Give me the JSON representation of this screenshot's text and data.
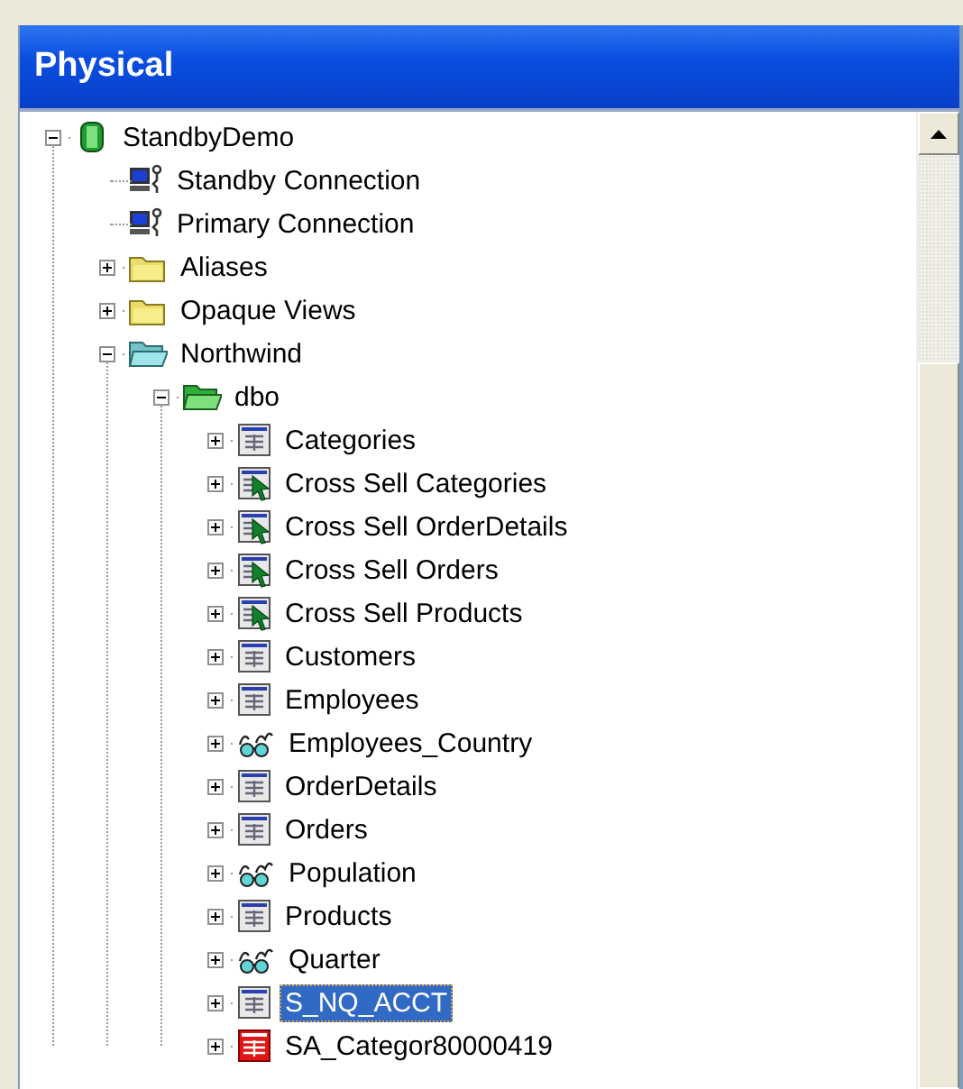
{
  "panel": {
    "title": "Physical"
  },
  "tree": [
    {
      "label": "StandbyDemo",
      "kind": "database",
      "expanded": true,
      "selected": false,
      "children": [
        {
          "label": "Standby Connection",
          "kind": "connection",
          "selected": false
        },
        {
          "label": "Primary Connection",
          "kind": "connection",
          "selected": false
        },
        {
          "label": "Aliases",
          "kind": "folder",
          "expanded": false,
          "selected": false
        },
        {
          "label": "Opaque Views",
          "kind": "folder",
          "expanded": false,
          "selected": false
        },
        {
          "label": "Northwind",
          "kind": "catalog",
          "expanded": true,
          "selected": false,
          "children": [
            {
              "label": "dbo",
              "kind": "schema",
              "expanded": true,
              "selected": false,
              "children": [
                {
                  "label": "Categories",
                  "kind": "table",
                  "expanded": false,
                  "selected": false
                },
                {
                  "label": "Cross Sell Categories",
                  "kind": "cursor-table",
                  "expanded": false,
                  "selected": false
                },
                {
                  "label": "Cross Sell OrderDetails",
                  "kind": "cursor-table",
                  "expanded": false,
                  "selected": false
                },
                {
                  "label": "Cross Sell Orders",
                  "kind": "cursor-table",
                  "expanded": false,
                  "selected": false
                },
                {
                  "label": "Cross Sell Products",
                  "kind": "cursor-table",
                  "expanded": false,
                  "selected": false
                },
                {
                  "label": "Customers",
                  "kind": "table",
                  "expanded": false,
                  "selected": false
                },
                {
                  "label": "Employees",
                  "kind": "table",
                  "expanded": false,
                  "selected": false
                },
                {
                  "label": "Employees_Country",
                  "kind": "view",
                  "expanded": false,
                  "selected": false
                },
                {
                  "label": "OrderDetails",
                  "kind": "table",
                  "expanded": false,
                  "selected": false
                },
                {
                  "label": "Orders",
                  "kind": "table",
                  "expanded": false,
                  "selected": false
                },
                {
                  "label": "Population",
                  "kind": "view",
                  "expanded": false,
                  "selected": false
                },
                {
                  "label": "Products",
                  "kind": "table",
                  "expanded": false,
                  "selected": false
                },
                {
                  "label": "Quarter",
                  "kind": "view",
                  "expanded": false,
                  "selected": false
                },
                {
                  "label": "S_NQ_ACCT",
                  "kind": "table",
                  "expanded": false,
                  "selected": true
                },
                {
                  "label": "SA_Categor80000419",
                  "kind": "alias-table",
                  "expanded": false,
                  "selected": false
                }
              ]
            }
          ]
        }
      ]
    }
  ]
}
